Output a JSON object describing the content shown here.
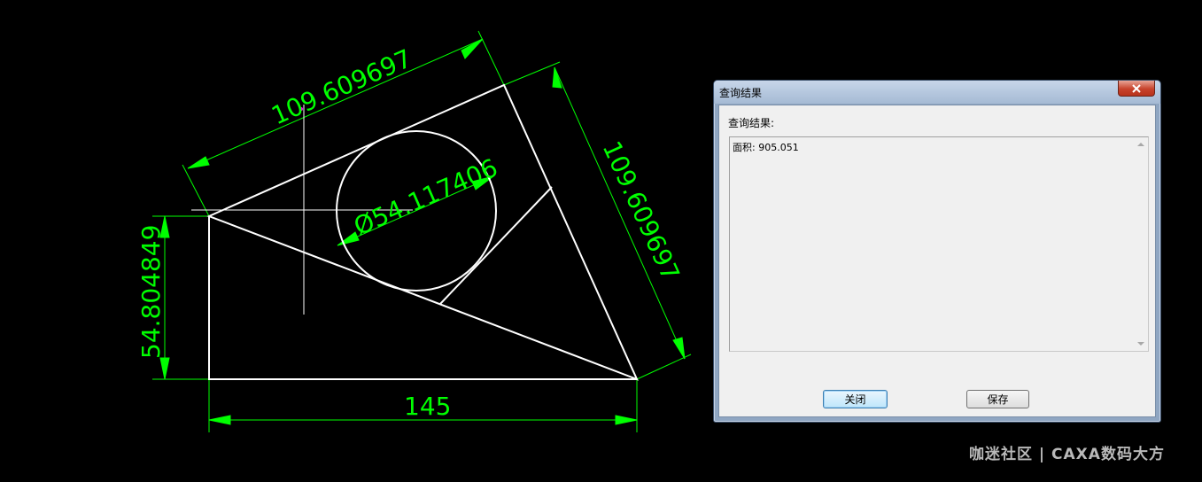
{
  "drawing": {
    "dims": {
      "top": "109.609697",
      "right": "109.609697",
      "diameter": "Ø54.117406",
      "left": "54.804849",
      "bottom": "145"
    },
    "colors": {
      "dimension": "#00ff00",
      "geometry": "#ffffff",
      "background": "#000000"
    }
  },
  "dialog": {
    "title": "查询结果",
    "close_icon": "close-x-icon",
    "result_label": "查询结果:",
    "result_text": "面积: 905.051",
    "buttons": {
      "close": "关闭",
      "save": "保存"
    }
  },
  "watermark": "咖迷社区 | CAXA数码大方"
}
